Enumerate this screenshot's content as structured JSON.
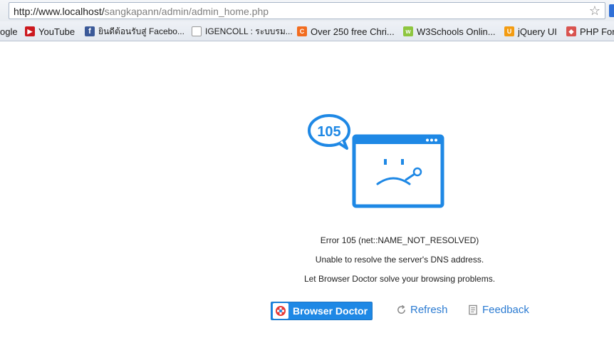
{
  "browser": {
    "url_host": "http://www.localhost/",
    "url_path": "sangkapann/admin/admin_home.php",
    "bookmark_star_icon": "star-icon"
  },
  "bookmarks": [
    {
      "label": "ogle",
      "icon": "google-icon"
    },
    {
      "label": "YouTube",
      "icon": "youtube-icon",
      "color": "#cc181e"
    },
    {
      "label": "ยินดีต้อนรับสู่ Facebo...",
      "icon": "facebook-icon",
      "color": "#3b5998"
    },
    {
      "label": "IGENCOLL : ระบบรม...",
      "icon": "page-icon"
    },
    {
      "label": "Over 250 free Chri...",
      "icon": "site-icon",
      "color": "#f26c1f"
    },
    {
      "label": "W3Schools Onlin...",
      "icon": "w3schools-icon",
      "color": "#8ec63f"
    },
    {
      "label": "jQuery UI",
      "icon": "jquery-ui-icon",
      "color": "#f39c12"
    },
    {
      "label": "PHP For",
      "icon": "php-icon",
      "color": "#d9534f"
    }
  ],
  "error": {
    "code": "105",
    "line1": "Error 105 (net::NAME_NOT_RESOLVED)",
    "line2": "Unable to resolve the server's DNS address.",
    "line3": "Let Browser Doctor solve your browsing problems.",
    "accent": "#1e88e5"
  },
  "actions": {
    "doctor_label": "Browser Doctor",
    "refresh_label": "Refresh",
    "feedback_label": "Feedback"
  }
}
